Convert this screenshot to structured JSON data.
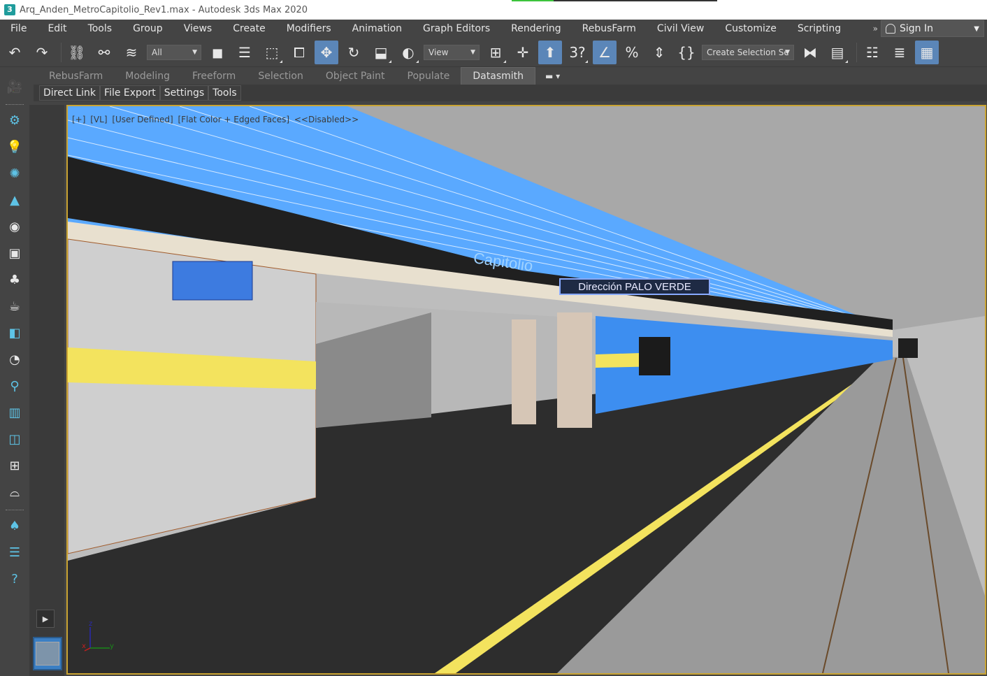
{
  "window": {
    "title": "Arq_Anden_MetroCapitolio_Rev1.max - Autodesk 3ds Max 2020",
    "app_icon_glyph": "3"
  },
  "menu": {
    "items": [
      "File",
      "Edit",
      "Tools",
      "Group",
      "Views",
      "Create",
      "Modifiers",
      "Animation",
      "Graph Editors",
      "Rendering",
      "RebusFarm",
      "Civil View",
      "Customize",
      "Scripting"
    ],
    "overflow": "»",
    "sign_in": "Sign In"
  },
  "toolbar": {
    "filter_select": "All",
    "ref_coord_select": "View",
    "selection_set_select": "Create Selection Se",
    "icons": [
      "undo-icon",
      "redo-icon",
      "link-icon",
      "unlink-icon",
      "bind-space-warp-icon",
      "select-object-icon",
      "select-by-name-icon",
      "rect-selection-icon",
      "window-crossing-icon",
      "select-move-icon",
      "select-rotate-icon",
      "select-scale-icon",
      "place-icon",
      "pivot-icon",
      "snap-3d-icon",
      "angle-snap-icon",
      "percent-snap-icon",
      "spinner-snap-icon",
      "named-selection-icon",
      "mirror-icon",
      "align-icon",
      "scene-explorer-icon",
      "layer-explorer-icon",
      "ribbon-toggle-icon"
    ]
  },
  "ribbon": {
    "tabs": [
      "RebusFarm",
      "Modeling",
      "Freeform",
      "Selection",
      "Object Paint",
      "Populate",
      "Datasmith"
    ],
    "active_tab": "Datasmith",
    "subtabs": [
      "Direct Link",
      "File Export",
      "Settings",
      "Tools"
    ]
  },
  "viewport": {
    "label_parts": [
      "[+]",
      "[VL]",
      "[User Defined]",
      "[Flat Color + Edged Faces]",
      "<<Disabled>>"
    ],
    "station_sign": "Capitolio",
    "direction_sign": "Dirección PALO VERDE",
    "axis": {
      "x": "x",
      "y": "y",
      "z": "z"
    },
    "colors": {
      "accent_border": "#c9a332",
      "floor": "#2d2d2d",
      "wall_yellow": "#f3e35e",
      "wall_blue": "#3d8ef0",
      "ceiling_blue": "#5aa9ff"
    }
  }
}
